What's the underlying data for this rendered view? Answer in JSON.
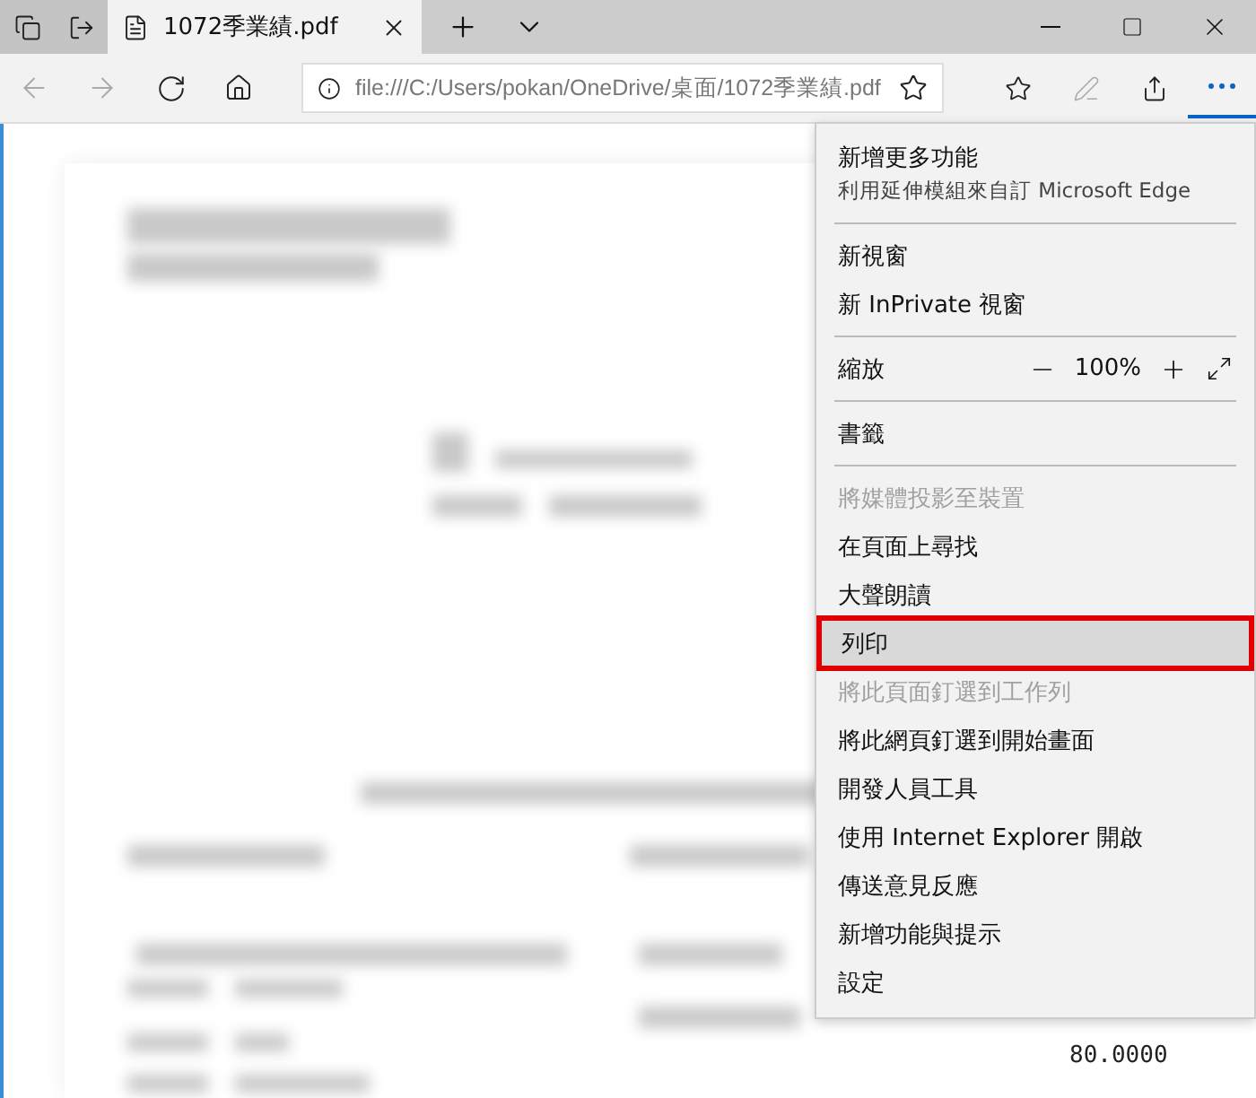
{
  "tabs": [
    {
      "title": "1072季業績.pdf",
      "selected": true
    }
  ],
  "address_bar": {
    "url": "file:///C:/Users/pokan/OneDrive/桌面/1072季業績.pdf"
  },
  "document": {
    "values": [
      "80.0000"
    ]
  },
  "menu": {
    "items": [
      {
        "kind": "header",
        "label": "新增更多功能",
        "description": "利用延伸模組來自訂 Microsoft Edge"
      },
      {
        "kind": "divider"
      },
      {
        "kind": "item",
        "label": "新視窗",
        "disabled": false,
        "selected": false,
        "marked": false
      },
      {
        "kind": "item",
        "label": "新 InPrivate 視窗",
        "disabled": false,
        "selected": false,
        "marked": false
      },
      {
        "kind": "divider"
      },
      {
        "kind": "zoom",
        "label": "縮放",
        "value": "100%"
      },
      {
        "kind": "divider"
      },
      {
        "kind": "item",
        "label": "書籤",
        "disabled": false,
        "selected": false,
        "marked": false
      },
      {
        "kind": "divider"
      },
      {
        "kind": "item",
        "label": "將媒體投影至裝置",
        "disabled": true,
        "selected": false,
        "marked": false
      },
      {
        "kind": "item",
        "label": "在頁面上尋找",
        "disabled": false,
        "selected": false,
        "marked": false
      },
      {
        "kind": "item",
        "label": "大聲朗讀",
        "disabled": false,
        "selected": false,
        "marked": false
      },
      {
        "kind": "item",
        "label": "列印",
        "disabled": false,
        "selected": true,
        "marked": true
      },
      {
        "kind": "item",
        "label": "將此頁面釘選到工作列",
        "disabled": true,
        "selected": false,
        "marked": false
      },
      {
        "kind": "item",
        "label": "將此網頁釘選到開始畫面",
        "disabled": false,
        "selected": false,
        "marked": false
      },
      {
        "kind": "item",
        "label": "開發人員工具",
        "disabled": false,
        "selected": false,
        "marked": false
      },
      {
        "kind": "item",
        "label": "使用 Internet Explorer 開啟",
        "disabled": false,
        "selected": false,
        "marked": false
      },
      {
        "kind": "item",
        "label": "傳送意見反應",
        "disabled": false,
        "selected": false,
        "marked": false
      },
      {
        "kind": "item",
        "label": "新增功能與提示",
        "disabled": false,
        "selected": false,
        "marked": false
      },
      {
        "kind": "item",
        "label": "設定",
        "disabled": false,
        "selected": false,
        "marked": false
      }
    ]
  }
}
